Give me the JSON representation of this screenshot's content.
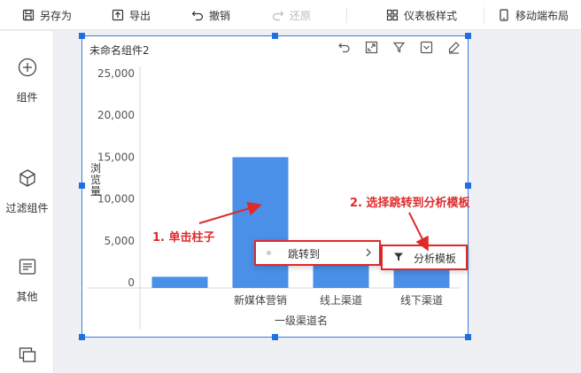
{
  "toolbar": {
    "save_as": "另存为",
    "export": "导出",
    "undo": "撤销",
    "redo": "还原",
    "dashboard_style": "仪表板样式",
    "mobile_layout": "移动端布局"
  },
  "sidebar": {
    "items": [
      {
        "label": "组件",
        "icon": "plus-circle-icon"
      },
      {
        "label": "过滤组件",
        "icon": "cube-icon"
      },
      {
        "label": "其他",
        "icon": "text-box-icon"
      },
      {
        "label": "",
        "icon": "layers-icon"
      }
    ]
  },
  "widget": {
    "title": "未命名组件2",
    "icons": [
      "undo-icon",
      "expand-icon",
      "filter-icon",
      "dropdown-icon",
      "edit-icon"
    ]
  },
  "chart_data": {
    "type": "bar",
    "categories": [
      "",
      "新媒体营销",
      "线上渠道",
      "线下渠道"
    ],
    "values": [
      700,
      15000,
      3700,
      3200
    ],
    "xlabel": "一级渠道名",
    "ylabel": "浏览量",
    "ylim": [
      0,
      25000
    ],
    "yticks": [
      0,
      5000,
      10000,
      15000,
      20000,
      25000
    ],
    "ytick_labels": [
      "0",
      "5,000",
      "10,000",
      "15,000",
      "20,000",
      "25,000"
    ],
    "bar_color": "#4a8fe8",
    "grid": false
  },
  "context_menu": {
    "item_label": "跳转到",
    "submenu_label": "分析模板"
  },
  "annotations": {
    "step1": "1. 单击柱子",
    "step2": "2. 选择跳转到分析模板",
    "color": "#e02a2a"
  }
}
